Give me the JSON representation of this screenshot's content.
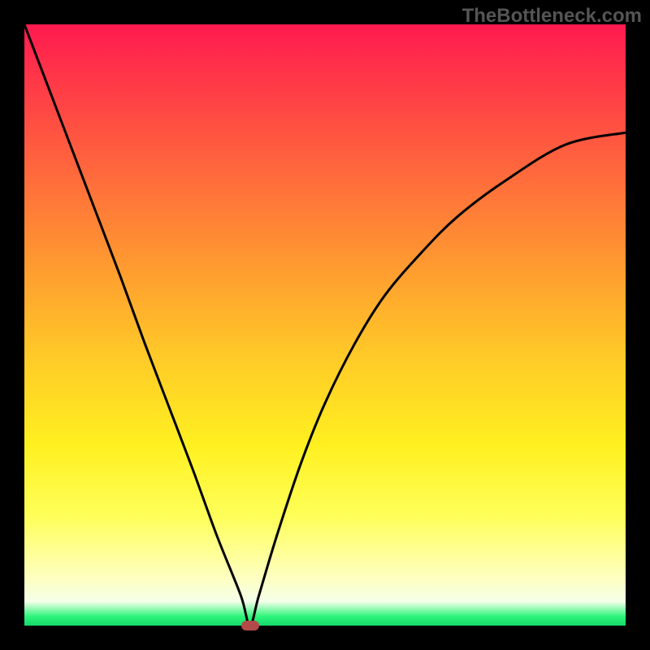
{
  "watermark": "TheBottleneck.com",
  "chart_data": {
    "type": "line",
    "title": "",
    "xlabel": "",
    "ylabel": "",
    "xlim": [
      0,
      100
    ],
    "ylim": [
      0,
      100
    ],
    "x": [
      0,
      4,
      8,
      12,
      16,
      20,
      24,
      28,
      32,
      36,
      37.5,
      39,
      42,
      46,
      50,
      55,
      60,
      66,
      72,
      80,
      90,
      100
    ],
    "values": [
      100,
      89.5,
      79,
      68.5,
      58,
      47,
      36.5,
      26,
      15,
      5,
      0,
      5,
      15,
      27,
      37,
      47,
      55,
      62,
      68,
      74,
      80,
      82
    ],
    "marker": {
      "x": 37.5,
      "y": 0
    },
    "background_gradient": [
      "#ff1a50",
      "#ff9a30",
      "#fff020",
      "#2cf47a"
    ]
  }
}
